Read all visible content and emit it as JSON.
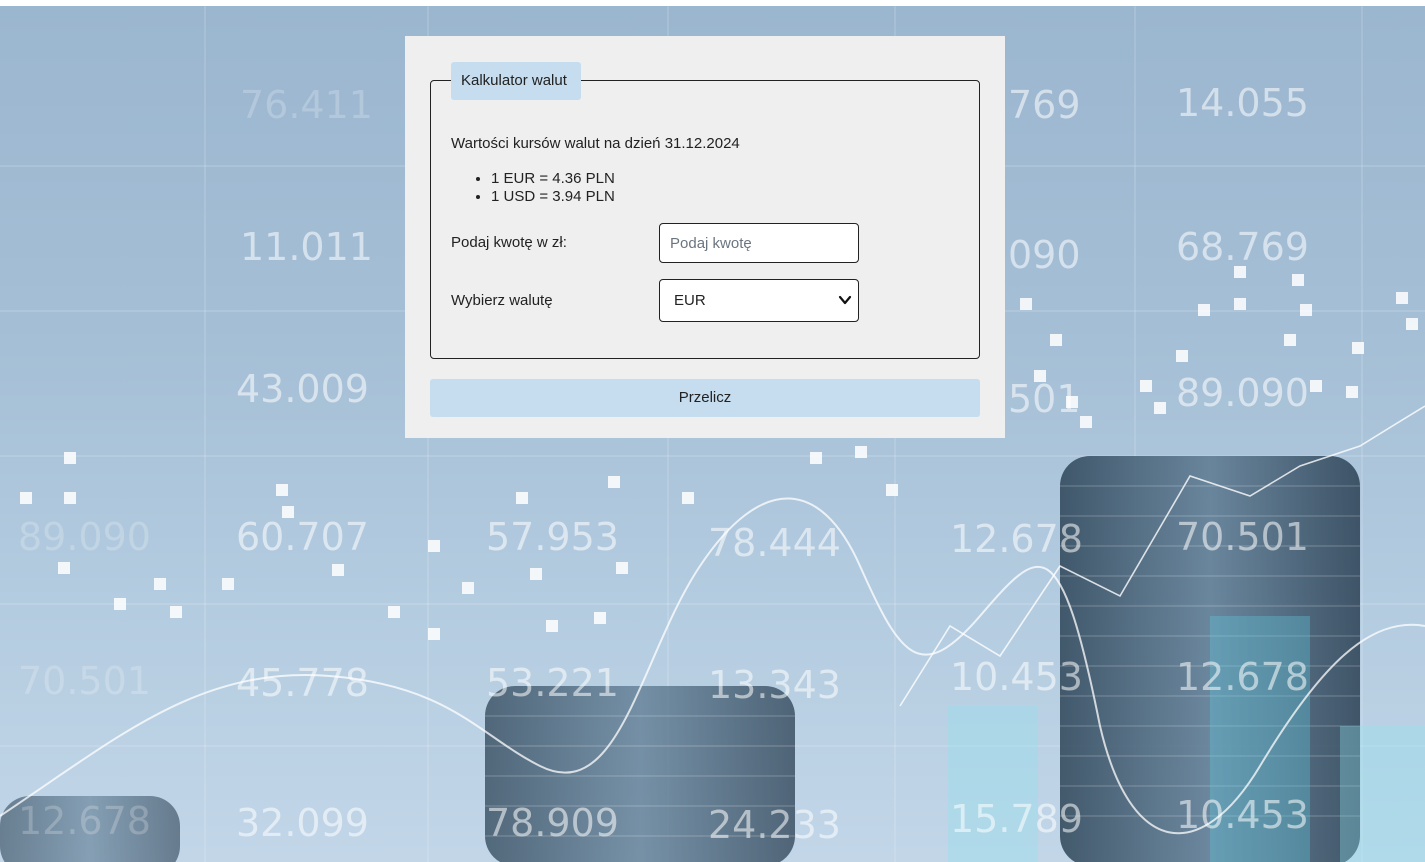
{
  "form": {
    "legend": "Kalkulator walut",
    "rates_title": "Wartości kursów walut na dzień 31.12.2024",
    "rates": [
      "1 EUR = 4.36 PLN",
      "1 USD = 3.94 PLN"
    ],
    "amount_label": "Podaj kwotę w zł:",
    "amount_placeholder": "Podaj kwotę",
    "amount_value": "",
    "currency_label": "Wybierz walutę",
    "currency_selected": "EUR",
    "submit_label": "Przelicz"
  },
  "background": {
    "numbers": [
      "76.411",
      "11.011",
      "43.009",
      "60.707",
      "45.778",
      "32.099",
      "57.953",
      "53.221",
      "78.909",
      "78.444",
      "13.343",
      "24.233",
      "769",
      "090",
      "501",
      "12.678",
      "10.453",
      "15.789",
      "14.055",
      "68.769",
      "89.090",
      "70.501",
      "12.678",
      "10.453",
      "70.501",
      "89.090",
      "12.678"
    ]
  },
  "colors": {
    "card_background": "#eeefee",
    "accent": "#c5ddef",
    "page_background": "#a5bfd6"
  }
}
